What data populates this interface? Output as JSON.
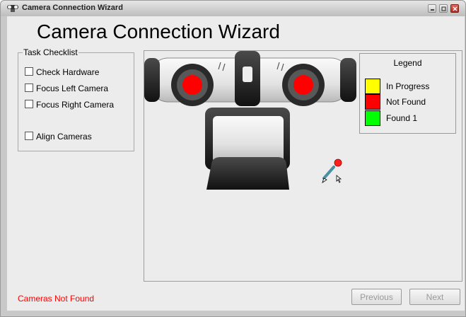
{
  "window": {
    "title": "Camera Connection Wizard",
    "icon": "stereo-camera-icon",
    "controls": [
      "minimize-icon",
      "maximize-icon",
      "close-icon"
    ]
  },
  "heading": "Camera Connection Wizard",
  "checklist": {
    "title": "Task Checklist",
    "items": [
      {
        "label": "Check Hardware",
        "checked": false
      },
      {
        "label": "Focus Left Camera",
        "checked": false
      },
      {
        "label": "Focus Right Camera",
        "checked": false
      },
      {
        "label": "Align Cameras",
        "checked": false
      }
    ]
  },
  "legend": {
    "title": "Legend",
    "items": [
      {
        "label": "In Progress",
        "color": "#ffff00"
      },
      {
        "label": "Not Found",
        "color": "#ff0000"
      },
      {
        "label": "Found 1",
        "color": "#00ff00"
      }
    ]
  },
  "camera": {
    "left_lens_color": "#ff0000",
    "right_lens_color": "#ff0000"
  },
  "status": {
    "text": "Cameras Not Found",
    "color": "#ff0000"
  },
  "buttons": {
    "previous": "Previous",
    "next": "Next"
  }
}
